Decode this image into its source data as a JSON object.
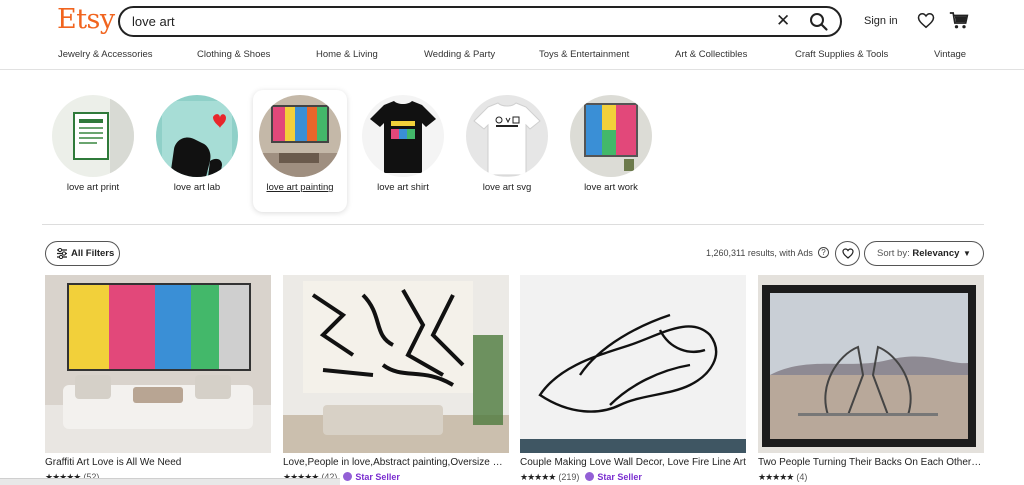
{
  "header": {
    "logo": "Etsy",
    "search_value": "love art",
    "sign_in": "Sign in"
  },
  "nav": [
    "Jewelry & Accessories",
    "Clothing & Shoes",
    "Home & Living",
    "Wedding & Party",
    "Toys & Entertainment",
    "Art & Collectibles",
    "Craft Supplies & Tools",
    "Vintage"
  ],
  "categories": [
    {
      "label": "love art print",
      "icon": "framed-print-thumbnail"
    },
    {
      "label": "love art lab",
      "icon": "dog-silhouette-thumbnail"
    },
    {
      "label": "love art painting",
      "icon": "graffiti-painting-thumbnail",
      "selected": true
    },
    {
      "label": "love art shirt",
      "icon": "black-tshirt-thumbnail"
    },
    {
      "label": "love art svg",
      "icon": "white-tshirt-thumbnail"
    },
    {
      "label": "love art work",
      "icon": "canvas-artwork-thumbnail"
    }
  ],
  "filters": {
    "all_filters": "All Filters",
    "results": "1,260,311 results, with Ads",
    "sort_label": "Sort by:",
    "sort_value": "Relevancy"
  },
  "listings": [
    {
      "title": "Graffiti Art Love is All We Need",
      "stars": "★★★★★",
      "reviews": "(52)",
      "star_seller": ""
    },
    {
      "title": "Love,People in love,Abstract painting,Oversize Wall Art",
      "stars": "★★★★★",
      "reviews": "(42)",
      "star_seller": "Star Seller"
    },
    {
      "title": "Couple Making Love Wall Decor, Love Fire Line Art",
      "stars": "★★★★★",
      "reviews": "(219)",
      "star_seller": "Star Seller"
    },
    {
      "title": "Two People Turning Their Backs On Each Other Canvas",
      "stars": "★★★★★",
      "reviews": "(4)",
      "star_seller": ""
    }
  ],
  "colors": {
    "brand": "#f1641e",
    "star_seller": "#7b2fd0"
  }
}
